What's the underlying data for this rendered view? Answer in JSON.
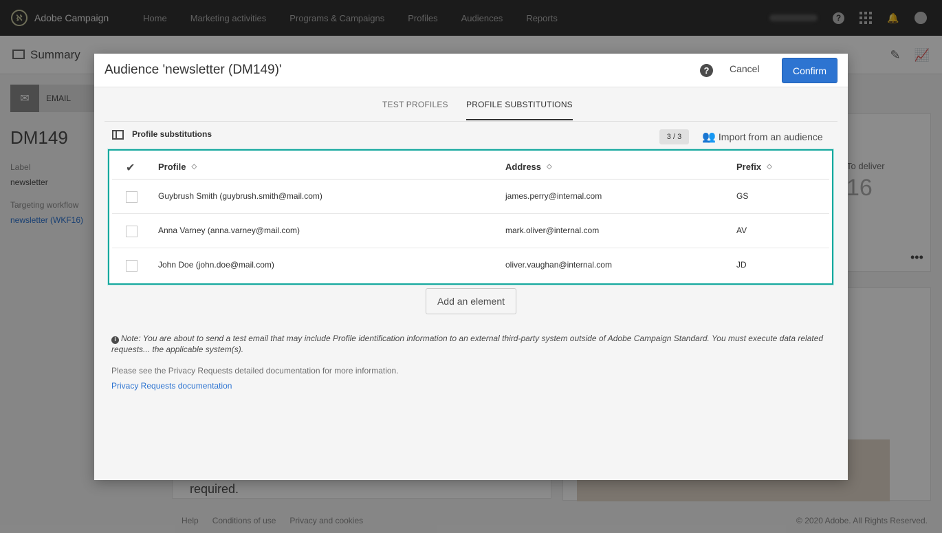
{
  "app": {
    "logo_text": "Adobe Campaign",
    "nav": [
      "Home",
      "Marketing activities",
      "Programs & Campaigns",
      "Profiles",
      "Audiences",
      "Reports"
    ]
  },
  "background": {
    "summary": "Summary",
    "email_tile": "EMAIL",
    "code": "DM149",
    "label_caption": "Label",
    "label_value": "newsletter",
    "workflow_caption": "Targeting workflow",
    "workflow_link": "newsletter (WKF16)",
    "to_deliver": "To deliver",
    "to_deliver_value": "16",
    "required_text": "required.",
    "footer": {
      "help": "Help",
      "conditions": "Conditions of use",
      "privacy": "Privacy and cookies",
      "copyright": "© 2020 Adobe. All Rights Reserved."
    }
  },
  "modal": {
    "title": "Audience 'newsletter (DM149)'",
    "cancel": "Cancel",
    "confirm": "Confirm",
    "tabs": [
      "TEST PROFILES",
      "PROFILE SUBSTITUTIONS"
    ],
    "active_tab": "PROFILE SUBSTITUTIONS",
    "section_title": "Profile substitutions",
    "count": "3 / 3",
    "import_label": "Import from an audience",
    "columns": [
      "Profile",
      "Address",
      "Prefix"
    ],
    "rows": [
      {
        "profile": "Guybrush Smith (guybrush.smith@mail.com)",
        "address": "james.perry@internal.com",
        "prefix": "GS"
      },
      {
        "profile": "Anna Varney (anna.varney@mail.com)",
        "address": "mark.oliver@internal.com",
        "prefix": "AV"
      },
      {
        "profile": "John Doe (john.doe@mail.com)",
        "address": "oliver.vaughan@internal.com",
        "prefix": "JD"
      }
    ],
    "add_element": "Add an element",
    "note": "Note: You are about to send a test email that may include Profile identification information to an external third-party system outside of Adobe Campaign Standard. You must execute data related requests... the applicable system(s).",
    "see_text": "Please see the Privacy Requests detailed documentation for more information.",
    "doc_link": "Privacy Requests documentation"
  },
  "colors": {
    "accent": "#2d74d1",
    "highlight": "#16a89e",
    "topbar": "#323232"
  }
}
